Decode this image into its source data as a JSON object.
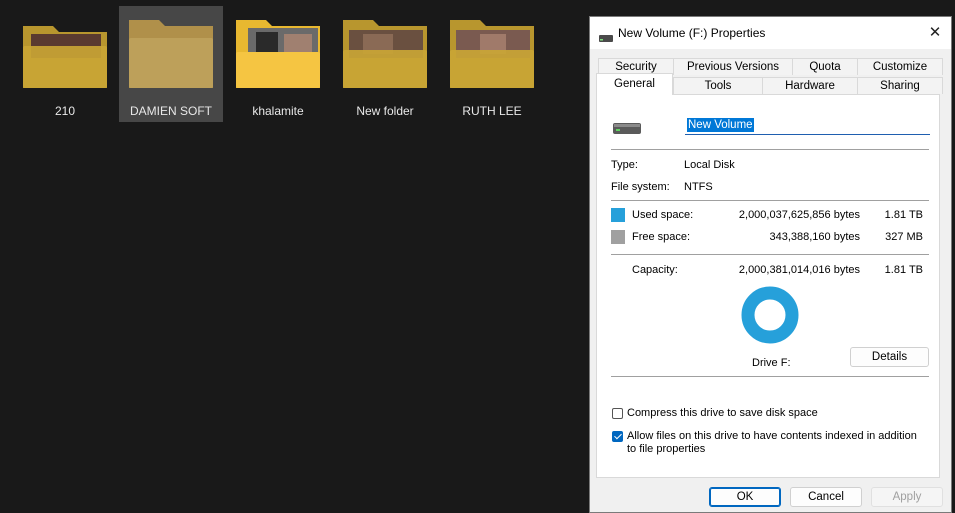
{
  "explorer": {
    "folders": [
      {
        "name": "210"
      },
      {
        "name": "DAMIEN SOFT"
      },
      {
        "name": "khalamite"
      },
      {
        "name": "New folder"
      },
      {
        "name": "RUTH LEE"
      }
    ]
  },
  "dialog": {
    "title": "New Volume (F:) Properties",
    "tabs_row1": [
      "Security",
      "Previous Versions",
      "Quota",
      "Customize"
    ],
    "tabs_row2": [
      "General",
      "Tools",
      "Hardware",
      "Sharing"
    ],
    "active_tab": "General",
    "volume_name": "New Volume",
    "type_label": "Type:",
    "type_value": "Local Disk",
    "fs_label": "File system:",
    "fs_value": "NTFS",
    "used_label": "Used space:",
    "used_bytes": "2,000,037,625,856 bytes",
    "used_human": "1.81 TB",
    "free_label": "Free space:",
    "free_bytes": "343,388,160 bytes",
    "free_human": "327 MB",
    "capacity_label": "Capacity:",
    "capacity_bytes": "2,000,381,014,016 bytes",
    "capacity_human": "1.81 TB",
    "drive_label": "Drive F:",
    "details_button": "Details",
    "compress_label": "Compress this drive to save disk space",
    "compress_checked": false,
    "index_label": "Allow files on this drive to have contents indexed in addition to file properties",
    "index_checked": true,
    "ok_button": "OK",
    "cancel_button": "Cancel",
    "apply_button": "Apply",
    "colors": {
      "used": "#26a0da",
      "free": "#a0a0a0",
      "accent": "#0078d7"
    }
  }
}
